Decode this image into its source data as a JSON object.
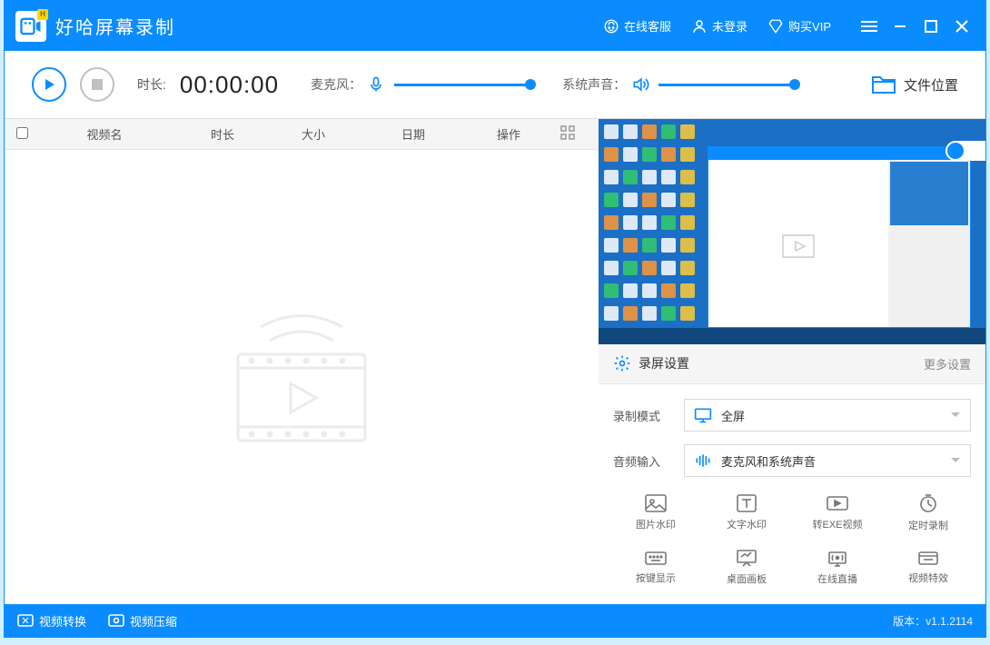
{
  "titlebar": {
    "app_name": "好哈屏幕录制",
    "customer_service": "在线客服",
    "login": "未登录",
    "buy_vip": "购买VIP"
  },
  "toolbar": {
    "duration_label": "时长:",
    "duration_value": "00:00:00",
    "microphone_label": "麦克风",
    "system_sound_label": "系统声音",
    "file_location": "文件位置"
  },
  "table": {
    "columns": {
      "name": "视频名",
      "duration": "时长",
      "size": "大小",
      "date": "日期",
      "operation": "操作"
    }
  },
  "settings": {
    "title": "录屏设置",
    "more": "更多设置",
    "record_mode_label": "录制模式",
    "record_mode_value": "全屏",
    "audio_input_label": "音频输入",
    "audio_input_value": "麦克风和系统声音",
    "tools": {
      "image_watermark": "图片水印",
      "text_watermark": "文字水印",
      "exe_convert": "转EXE视频",
      "timed_record": "定时录制",
      "key_display": "按键显示",
      "desktop_board": "桌面画板",
      "live_stream": "在线直播",
      "video_effect": "视频特效"
    }
  },
  "bottombar": {
    "video_convert": "视频转换",
    "video_compress": "视频压缩",
    "version": "版本：v1.1.2114"
  }
}
